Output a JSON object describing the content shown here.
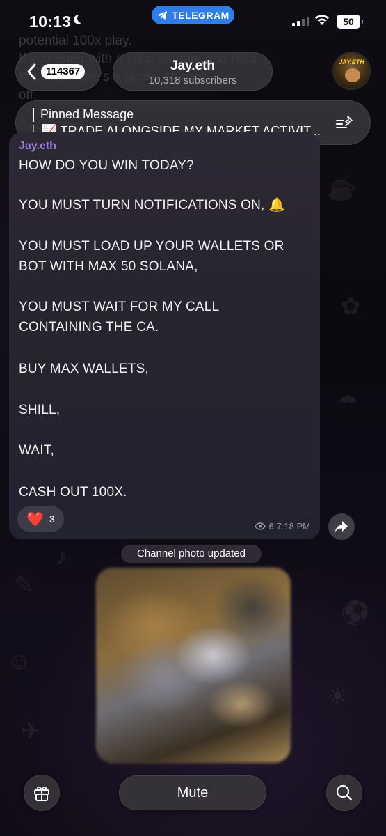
{
  "status_bar": {
    "time": "10:13",
    "app_pill": "TELEGRAM",
    "battery": "50"
  },
  "background_text": {
    "line1": "potential 100x play.",
    "line2": "If you enter with a solid amount and hold",
    "line3": "the bag, there's a strong chance",
    "line4": "off."
  },
  "header": {
    "back_count": "114367",
    "title": "Jay.eth",
    "subtitle": "10,318 subscribers",
    "avatar_label": "JAY.ETH"
  },
  "pinned": {
    "label": "Pinned Message",
    "text": "📈 TRADE ALONGSIDE MY MARKET ACTIVIT..."
  },
  "message": {
    "sender": "Jay.eth",
    "lines": [
      "HOW DO YOU WIN TODAY?",
      "YOU MUST TURN NOTIFICATIONS ON, 🔔",
      "YOU MUST LOAD UP YOUR WALLETS OR",
      "BOT WITH MAX 50 SOLANA,",
      "YOU MUST WAIT FOR MY CALL",
      "CONTAINING THE CA.",
      "BUY MAX WALLETS,",
      "SHILL,",
      "WAIT,",
      "CASH OUT 100X."
    ],
    "reaction_emoji": "❤️",
    "reaction_count": "3",
    "views": "6",
    "time": "7:18 PM"
  },
  "service_message": "Channel photo updated",
  "bottom_bar": {
    "mute_label": "Mute"
  },
  "colors": {
    "accent": "#2f7de8",
    "sender": "#9a7ed6",
    "bubble": "#29252f"
  }
}
